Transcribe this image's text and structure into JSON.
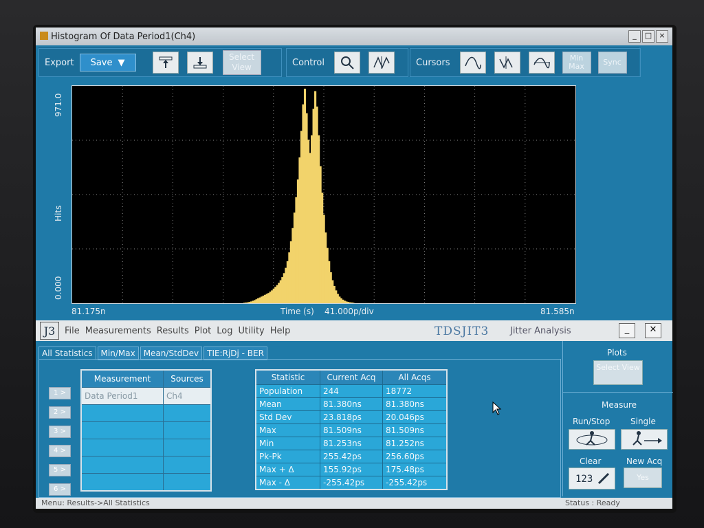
{
  "window": {
    "title": "Histogram Of Data Period1(Ch4)",
    "buttons": [
      "_",
      "□",
      "×"
    ]
  },
  "toolbar": {
    "export_label": "Export",
    "save_label": "Save",
    "select_view_label": "Select View",
    "control_label": "Control",
    "cursors_label": "Cursors",
    "minmax_label": "Min Max",
    "sync_label": "Sync"
  },
  "chart_data": {
    "type": "bar",
    "title": "",
    "xlabel": "Time (s)",
    "xscale_note": "41.000p/div",
    "ylabel": "Hits",
    "xlim_labels": [
      "81.175n",
      "81.585n"
    ],
    "ylim_labels": [
      "0.000",
      "971.0"
    ],
    "ylim": [
      0,
      971
    ],
    "grid": true,
    "bar_color": "#f2d36b",
    "values": [
      2,
      3,
      4,
      6,
      8,
      11,
      14,
      18,
      22,
      26,
      30,
      34,
      38,
      42,
      46,
      52,
      58,
      66,
      74,
      82,
      92,
      104,
      118,
      136,
      160,
      190,
      230,
      280,
      340,
      410,
      480,
      560,
      660,
      780,
      900,
      971,
      860,
      740,
      680,
      760,
      880,
      960,
      890,
      760,
      620,
      500,
      400,
      320,
      250,
      190,
      140,
      104,
      78,
      58,
      42,
      30,
      22,
      16,
      11,
      8,
      6,
      4,
      3,
      2
    ]
  },
  "lower": {
    "menu": [
      "File",
      "Measurements",
      "Results",
      "Plot",
      "Log",
      "Utility",
      "Help"
    ],
    "brand": "TDSJIT3",
    "brand_sub": "Jitter Analysis",
    "tabs": [
      "All Statistics",
      "Min/Max",
      "Mean/StdDev",
      "TIE:RjDj - BER"
    ],
    "row_numbers": [
      "1 >",
      "2 >",
      "3 >",
      "4 >",
      "5 >",
      "6 >"
    ],
    "measure_headers": [
      "Measurement",
      "Sources"
    ],
    "measure_rows": [
      [
        "Data Period1",
        "Ch4"
      ],
      [
        "",
        ""
      ],
      [
        "",
        ""
      ],
      [
        "",
        ""
      ],
      [
        "",
        ""
      ],
      [
        "",
        ""
      ]
    ],
    "stat_headers": [
      "Statistic",
      "Current Acq",
      "All Acqs"
    ],
    "stat_rows": [
      [
        "Population",
        "244",
        "18772"
      ],
      [
        "Mean",
        "81.380ns",
        "81.380ns"
      ],
      [
        "Std Dev",
        "23.818ps",
        "20.046ps"
      ],
      [
        "Max",
        "81.509ns",
        "81.509ns"
      ],
      [
        "Min",
        "81.253ns",
        "81.252ns"
      ],
      [
        "Pk-Pk",
        "255.42ps",
        "256.60ps"
      ],
      [
        "Max + Δ",
        "155.92ps",
        "175.48ps"
      ],
      [
        "Max - Δ",
        "-255.42ps",
        "-255.42ps"
      ]
    ],
    "right": {
      "plots_label": "Plots",
      "select_view_label": "Select View",
      "measure_label": "Measure",
      "runstop_label": "Run/Stop",
      "single_label": "Single",
      "clear_label": "Clear",
      "newacq_label": "New Acq",
      "yes_label": "Yes"
    }
  },
  "status": {
    "menu_path": "Menu: Results->All Statistics",
    "status_text": "Status : Ready"
  }
}
